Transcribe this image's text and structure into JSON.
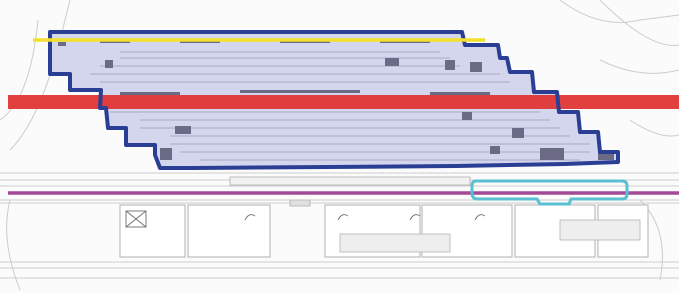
{
  "image": {
    "kind": "annotated architectural plan drawing",
    "text_labels_visible": []
  },
  "colors": {
    "background": "#fbfbfb",
    "plan_line": "#c8c8c8",
    "plan_line_dark": "#9a9a9a",
    "building_fill": "#d4d6ee",
    "building_outline": "#2a3f93",
    "red_band": "#e0302f",
    "yellow_line": "#f1e02a",
    "magenta_line": "#a34a97",
    "cyan_outline": "#58c0d0"
  },
  "overlays": [
    {
      "name": "blue-building-outline",
      "color_key": "building_outline",
      "shape": "stepped polygon"
    },
    {
      "name": "red-band",
      "color_key": "red_band",
      "shape": "horizontal band"
    },
    {
      "name": "yellow-line",
      "color_key": "yellow_line",
      "shape": "horizontal line"
    },
    {
      "name": "magenta-line",
      "color_key": "magenta_line",
      "shape": "horizontal line"
    },
    {
      "name": "cyan-outline",
      "color_key": "cyan_outline",
      "shape": "rounded polygon"
    }
  ]
}
